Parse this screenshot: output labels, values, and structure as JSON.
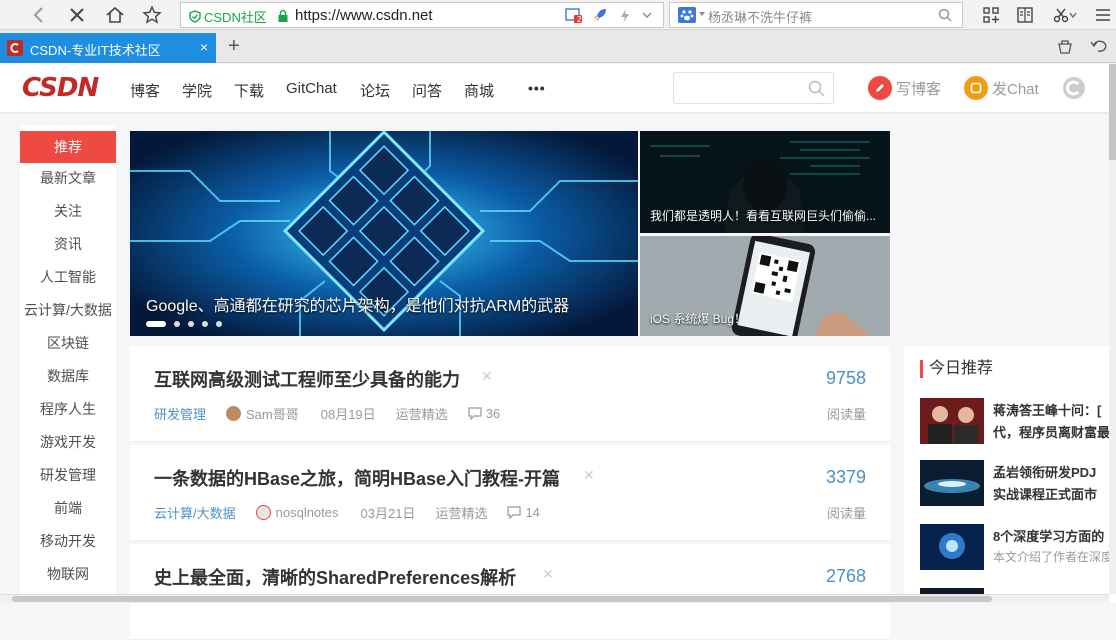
{
  "browser": {
    "site_badge": "CSDN社区",
    "url": "https://www.csdn.net",
    "search_placeholder": "杨丞琳不洗牛仔裤",
    "badge_count": "2",
    "tab_title": "CSDN-专业IT技术社区",
    "tab_close": "×",
    "new_tab": "+"
  },
  "header": {
    "logo": "CSDN",
    "nav": [
      "博客",
      "学院",
      "下载",
      "GitChat",
      "论坛",
      "问答",
      "商城",
      "•••"
    ],
    "write_blog": "写博客",
    "chat": "发Chat"
  },
  "leftnav": {
    "items": [
      "推荐",
      "最新文章",
      "关注",
      "资讯",
      "人工智能",
      "云计算/大数据",
      "区块链",
      "数据库",
      "程序人生",
      "游戏开发",
      "研发管理",
      "前端",
      "移动开发",
      "物联网"
    ]
  },
  "banners": {
    "main_caption": "Google、高通都在研究的芯片架构，是他们对抗ARM的武器",
    "side1_caption": "我们都是透明人！看看互联网巨头们偷偷...",
    "side2_caption": "iOS 系统爆 Bug！"
  },
  "articles": [
    {
      "title": "互联网高级测试工程师至少具备的能力",
      "category": "研发管理",
      "author": "Sam哥哥",
      "date": "08月19日",
      "source": "运营精选",
      "comments": "36",
      "reads": "9758",
      "read_label": "阅读量"
    },
    {
      "title": "一条数据的HBase之旅，简明HBase入门教程-开篇",
      "category": "云计算/大数据",
      "author": "nosqlnotes",
      "date": "03月21日",
      "source": "运营精选",
      "comments": "14",
      "reads": "3379",
      "read_label": "阅读量"
    },
    {
      "title": "史上最全面，清晰的SharedPreferences解析",
      "reads": "2768"
    }
  ],
  "recommend": {
    "title": "今日推荐",
    "items": [
      {
        "line1": "蒋涛答王峰十问：[",
        "line2": "代，程序员离财富最"
      },
      {
        "line1": "孟岩领衔研发PDJ",
        "line2": "实战课程正式面市"
      },
      {
        "line1": "8个深度学习方面的",
        "line2": "本文介绍了作者在深度"
      }
    ]
  },
  "colors": {
    "accent_red": "#ef4943",
    "link_blue": "#4d90c8",
    "tab_blue": "#1f8ee0",
    "brand_red": "#c32a27"
  }
}
